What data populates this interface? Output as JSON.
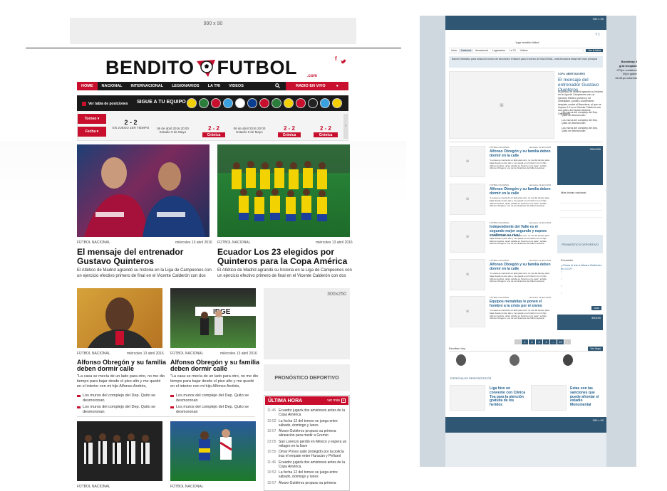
{
  "top_ad": "990 x 90",
  "logo": {
    "text_left": "BENDITO",
    "text_right": "FUTBOL",
    "domain": ".com"
  },
  "nav": {
    "items": [
      "HOME",
      "NACIONAL",
      "INTERNACIONAL",
      "LEGIONARIOS",
      "LA TRI",
      "VIDEOS"
    ],
    "radio": "RADIO EN VIVO"
  },
  "scores": {
    "tabla": "Ver tabla de posiciones",
    "follow": "SIGUE A TU EQUIPO",
    "torneo": "Torneo",
    "fecha": "Fecha",
    "matches": [
      {
        "score": "2 - 2",
        "status": "EN JUEGO 1ER TIEMPO"
      },
      {
        "score": "2 - 2",
        "date": "06 de abril 2016 20:00",
        "venue": "Estadio 9 de Mayo",
        "button": "Crónica"
      },
      {
        "score": "2 - 2",
        "date": "06 de abril 2016 20:00",
        "venue": "Estadio 9 de Mayo",
        "button": "Crónica"
      },
      {
        "score": "2 - 2",
        "button": "Crónica"
      }
    ]
  },
  "featured": [
    {
      "section": "FÚTBOL NACIONAL",
      "date": "miércoles 13 abril 2016",
      "headline": "El mensaje del entrenador Gustavo Quinteros",
      "body": "El Atlético de Madrid agrandó su historia en la Liga de Campeones con un ejercicio efectivo primero de final en el Vicente Calderón con dos"
    },
    {
      "section": "FÚTBOL NACIONAL",
      "date": "miércoles 13 abril 2016",
      "headline": "Ecuador Los 23 elegidos por Quinteros para la Copa América",
      "body": "El Atlético de Madrid agrandó su historia en la Liga de Campeones con un ejercicio efectivo primero de final en el Vicente Calderón con dos"
    }
  ],
  "small_cards": [
    {
      "section": "FÚTBOL NACIONAL",
      "date": "miércoles 13 abril 2016",
      "headline": "Alfonso Obregón y su familia deben dormir calle",
      "body": "\"La casa se mecía de un lado para otro, no me dio tiempo para bajar desde el piso alto y me quedé en el interior con mi hijo Alfonso Andrés,",
      "links": [
        "Los muros del complejo del Dep. Quito se desmoronan",
        "Los muros del complejo del Dep. Quito se desmoronan"
      ]
    },
    {
      "section": "FÚTBOL NACIONAL",
      "date": "miércoles 13 abril 2016",
      "headline": "Alfonso Obregón y su familia deben dormir calle",
      "body": "\"La casa se mecía de un lado para otro, no me dio tiempo para bajar desde el piso alto y me quedé en el interior con mi hijo Alfonso Andrés,",
      "links": [
        "Los muros del complejo del Dep. Quito se desmoronan",
        "Los muros del complejo del Dep. Quito se desmoronan"
      ]
    }
  ],
  "bottom_sections": [
    "FÚTBOL NACIONAL",
    "FÚTBOL NACIONAL"
  ],
  "side": {
    "ad": "300x250",
    "pronostico": "PRONÓSTICO DEPORTIVO",
    "ultima": "ÚLTIMA HORA",
    "ver_mas": "ver más",
    "items": [
      {
        "t": "11:45",
        "text": "Ecuador jugará dos amistosos antes de la Copa América"
      },
      {
        "t": "10:52",
        "text": "La fecha 12 del torneo se juega entre sábado, domingo y lunes"
      },
      {
        "t": "10:07",
        "text": "Álvaro Gutiérrez propuso su primera alineación para medir a Gremio"
      },
      {
        "t": "23:05",
        "text": "San Lorenzo perdió en México y espera un milagro en la llave"
      },
      {
        "t": "10:55",
        "text": "Omar Ponce salió protegido por la policía tras el empate entre Huracán y Peñarol"
      },
      {
        "t": "11:46",
        "text": "Ecuador jugará dos amistosos antes de la Copa América"
      },
      {
        "t": "10:52",
        "text": "La fecha 12 del torneo se juega entre sábado, domingo y lunes"
      },
      {
        "t": "10:07",
        "text": "Álvaro Gutiérrez propuso su primera"
      }
    ]
  },
  "grid": {
    "top_ad": "990 x 90",
    "logo_text": "logo bendito fútbol",
    "nav": [
      "Inicio",
      "Nacional",
      "Iternacional",
      "Legionarios",
      "La Tri",
      "Videos"
    ],
    "nav_right": "Ver la tabla",
    "banner": "Banner llamativo para todas los torneo de secciones. Enlaces para el torneo de NACIONAL, más llevada la listad del inicio principal",
    "note": [
      "Bootstrap 3",
      "grid template",
      "970px container",
      "30px gutter",
      "60-81px columns"
    ],
    "feature": {
      "label": "COPA LIBERTADORES",
      "title": "El mensaje del entrenador Gustavo Quinteros",
      "body": "El Atlético de Madrid agrandó su historia en la Liga de Campeones con un ejercicio efectivo primero y de inmediatez, puntal u sublemente después contra el Barcelona, al que se impuso 2-0 en el Vicente Calderón con dos goles del francés Antoine Griezmann.",
      "links": [
        "Los muros del complejo del Dep. Quito se desmoronan",
        "Los muros del complejo del Dep. Quito se desmoronan",
        "Los muros del complejo del Dep. Quito se desmoronan"
      ]
    },
    "items": [
      {
        "label": "FÚTBOL NACIONAL",
        "title": "Alfonso Obregón y su familia deben dormir en la calle"
      },
      {
        "label": "FÚTBOL NACIONAL",
        "title": "Alfonso Obregón y su familia deben dormir en la calle"
      },
      {
        "label": "FÚTBOL NACIONAL",
        "title": "Independiente del Valle es el segundo mejor segundo y espera confirmar su rival"
      },
      {
        "label": "FÚTBOL NACIONAL",
        "title": "Alfonso Obregón y su familia deben dormir en la calle"
      },
      {
        "label": "FÚTBOL NACIONAL",
        "title": "Equipos menabitas le ponen el hombro a la crisis por el sismo"
      }
    ],
    "item_date": "miércoles 13 abril 2016",
    "item_body": "\"La casa se mecía de un lado para otro, no me dio tiempo para bajar desde el piso alto y me quedé en el interior con mi hijo Alfonso Andrés, quién estaba su historia en la casa\", señala Alfonso Obregón, uno de los históricos del fútbol nacional.",
    "side_ad": "300x250",
    "mas_leidas": "Más leídas nacional",
    "pronostico": "PRONÓSTICO DEPORTIVO",
    "encuesta": "Encuesta",
    "encuesta_q": "¿Cómo le fue a Álvaro Gutiérrez en CCV?",
    "votar": "votar",
    "side_ad2": "300x90",
    "escriben": "Escriben hoy",
    "ver_blogs": "Ver blogs",
    "especiales": "ESPECIALES PERIODÍSTICOS",
    "esp1": "Liga hizo un convenio con Clínica Toa para la atención gratuita de los heridos",
    "esp2": "Estas son las sanciones que puede afrontar el estadio Monumental",
    "bottom_ad": "990 x 90"
  }
}
